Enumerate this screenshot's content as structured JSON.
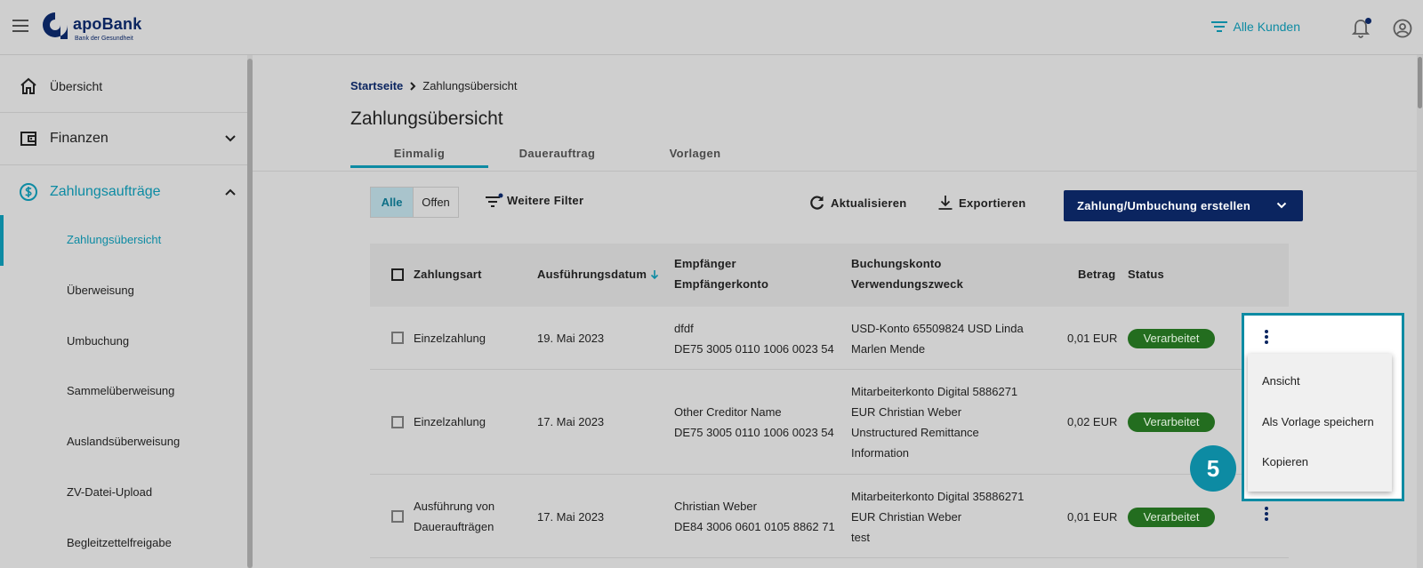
{
  "header": {
    "logo_name": "apoBank",
    "logo_subtitle": "Bank der Gesundheit",
    "customers_label": "Alle Kunden"
  },
  "sidebar": {
    "items": [
      {
        "label": "Übersicht"
      },
      {
        "label": "Finanzen"
      },
      {
        "label": "Zahlungsaufträge"
      }
    ],
    "sub_items": [
      {
        "label": "Zahlungsübersicht"
      },
      {
        "label": "Überweisung"
      },
      {
        "label": "Umbuchung"
      },
      {
        "label": "Sammelüberweisung"
      },
      {
        "label": "Auslandsüberweisung"
      },
      {
        "label": "ZV-Datei-Upload"
      },
      {
        "label": "Begleitzettelfreigabe"
      }
    ]
  },
  "main": {
    "breadcrumb_home": "Startseite",
    "breadcrumb_current": "Zahlungsübersicht",
    "title": "Zahlungsübersicht",
    "tabs": [
      {
        "label": "Einmalig"
      },
      {
        "label": "Dauerauftrag"
      },
      {
        "label": "Vorlagen"
      }
    ],
    "filter_all": "Alle",
    "filter_open": "Offen",
    "more_filters": "Weitere Filter",
    "refresh": "Aktualisieren",
    "export": "Exportieren",
    "create": "Zahlung/Umbuchung erstellen"
  },
  "table": {
    "headers": {
      "type": "Zahlungsart",
      "date": "Ausführungsdatum",
      "recipient": "Empfänger",
      "recipient_account": "Empfängerkonto",
      "booking_account": "Buchungskonto",
      "purpose": "Verwendungszweck",
      "amount": "Betrag",
      "status": "Status"
    },
    "rows": [
      {
        "type1": "Einzelzahlung",
        "type2": "",
        "date": "19. Mai 2023",
        "recipient": "dfdf",
        "recipient_account": "DE75 3005 0110 1006 0023 54",
        "booking1": "USD-Konto 65509824 USD Linda",
        "booking2": "Marlen Mende",
        "booking3": "",
        "booking4": "",
        "amount": "0,01 EUR",
        "status": "Verarbeitet"
      },
      {
        "type1": "Einzelzahlung",
        "type2": "",
        "date": "17. Mai 2023",
        "recipient": "Other Creditor Name",
        "recipient_account": "DE75 3005 0110 1006 0023 54",
        "booking1": "Mitarbeiterkonto Digital 5886271",
        "booking2": "EUR Christian Weber",
        "booking3": "Unstructured Remittance",
        "booking4": "Information",
        "amount": "0,02 EUR",
        "status": "Verarbeitet"
      },
      {
        "type1": "Ausführung von",
        "type2": "Daueraufträgen",
        "date": "17. Mai 2023",
        "recipient": "Christian Weber",
        "recipient_account": "DE84 3006 0601 0105 8862 71",
        "booking1": "Mitarbeiterkonto Digital 35886271",
        "booking2": "EUR Christian Weber",
        "booking3": "test",
        "booking4": "",
        "amount": "0,01 EUR",
        "status": "Verarbeitet"
      }
    ]
  },
  "context_menu": {
    "items": [
      {
        "label": "Ansicht"
      },
      {
        "label": "Als Vorlage speichern"
      },
      {
        "label": "Kopieren"
      }
    ]
  },
  "step_badge": "5",
  "colors": {
    "brand": "#0b2560",
    "accent": "#0d8ba3",
    "status_green": "#236d1f"
  }
}
